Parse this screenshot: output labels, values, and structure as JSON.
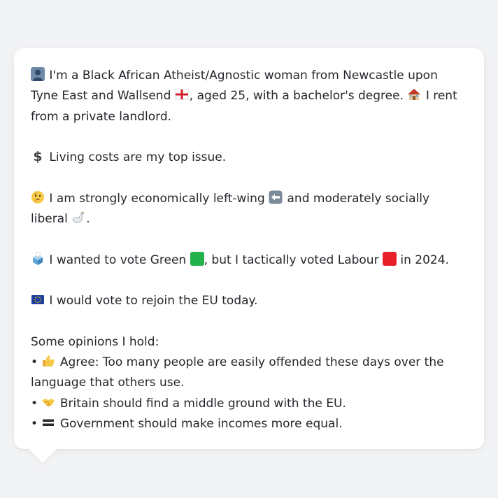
{
  "profile": {
    "line1": "I'm a Black African Atheist/Agnostic woman from Newcastle upon Tyne East and Wallsend",
    "line1b": ", aged 25, with a bachelor's degree.",
    "line1c": "I rent from a private landlord."
  },
  "issue": {
    "text": "Living costs are my top issue."
  },
  "ideology": {
    "text_a": "I am strongly economically left-wing",
    "text_b": "and moderately socially liberal",
    "text_c": "."
  },
  "vote": {
    "text_a": "I wanted to vote Green",
    "text_b": ", but I tactically voted Labour",
    "text_c": "in 2024."
  },
  "eu": {
    "text": "I would vote to rejoin the EU today."
  },
  "opinions": {
    "heading": "Some opinions I hold:",
    "items": [
      {
        "bullet": "•",
        "text": "Agree: Too many people are easily offended these days over the language that others use."
      },
      {
        "bullet": "•",
        "text": "Britain should find a middle ground with the EU."
      },
      {
        "bullet": "•",
        "text": "Government should make incomes more equal."
      }
    ]
  },
  "colors": {
    "green": "#22b14c",
    "labour_red": "#e8202a",
    "text": "#24272c"
  },
  "icons": [
    "person-icon",
    "england-flag-icon",
    "house-icon",
    "dollar-icon",
    "thinking-face-icon",
    "left-arrow-icon",
    "dove-icon",
    "ballot-box-icon",
    "green-square-icon",
    "red-square-icon",
    "eu-flag-icon",
    "thumbs-up-icon",
    "handshake-icon",
    "equals-icon"
  ]
}
